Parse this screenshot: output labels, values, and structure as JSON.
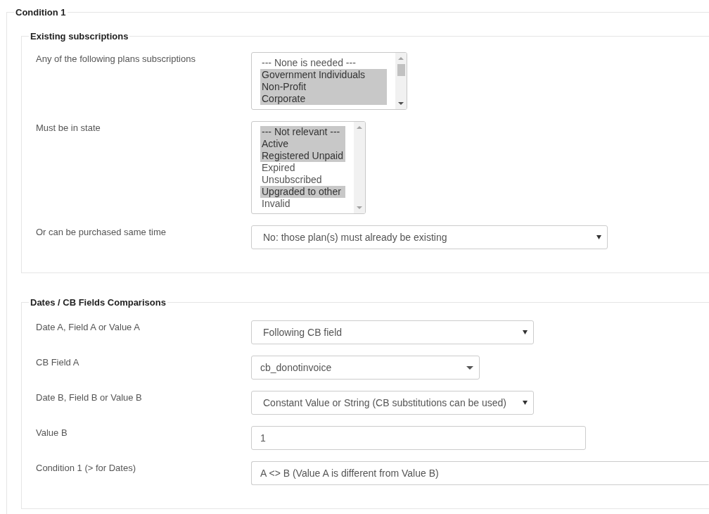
{
  "condition": {
    "legend": "Condition 1",
    "fieldsets": [
      {
        "legend": "Existing subscriptions",
        "rows": [
          {
            "kind": "listbox",
            "label": "Any of the following plans subscriptions",
            "options": [
              {
                "text": "--- None is needed ---",
                "selected": false
              },
              {
                "text": "Government Individuals",
                "selected": true
              },
              {
                "text": "Non-Profit",
                "selected": true
              },
              {
                "text": "Corporate",
                "selected": true
              }
            ]
          },
          {
            "kind": "listbox",
            "label": "Must be in state",
            "options": [
              {
                "text": "--- Not relevant ---",
                "selected": true
              },
              {
                "text": "Active",
                "selected": true
              },
              {
                "text": "Registered Unpaid",
                "selected": true
              },
              {
                "text": "Expired",
                "selected": false
              },
              {
                "text": "Unsubscribed",
                "selected": false
              },
              {
                "text": "Upgraded to other",
                "selected": true
              },
              {
                "text": "Invalid",
                "selected": false
              }
            ]
          },
          {
            "kind": "select",
            "label": "Or can be purchased same time",
            "value": "No: those plan(s) must already be existing"
          }
        ]
      },
      {
        "legend": "Dates / CB Fields Comparisons",
        "rows": [
          {
            "kind": "select",
            "label": "Date A, Field A or Value A",
            "value": "Following CB field"
          },
          {
            "kind": "combo",
            "label": "CB Field A",
            "value": "cb_donotinvoice"
          },
          {
            "kind": "select",
            "label": "Date B, Field B or Value B",
            "value": "Constant Value or String (CB substitutions can be used)"
          },
          {
            "kind": "input",
            "label": "Value B",
            "value": "1"
          },
          {
            "kind": "input",
            "label": "Condition 1 (> for Dates)",
            "value": "A <> B (Value A is different from Value B)"
          }
        ]
      }
    ]
  }
}
